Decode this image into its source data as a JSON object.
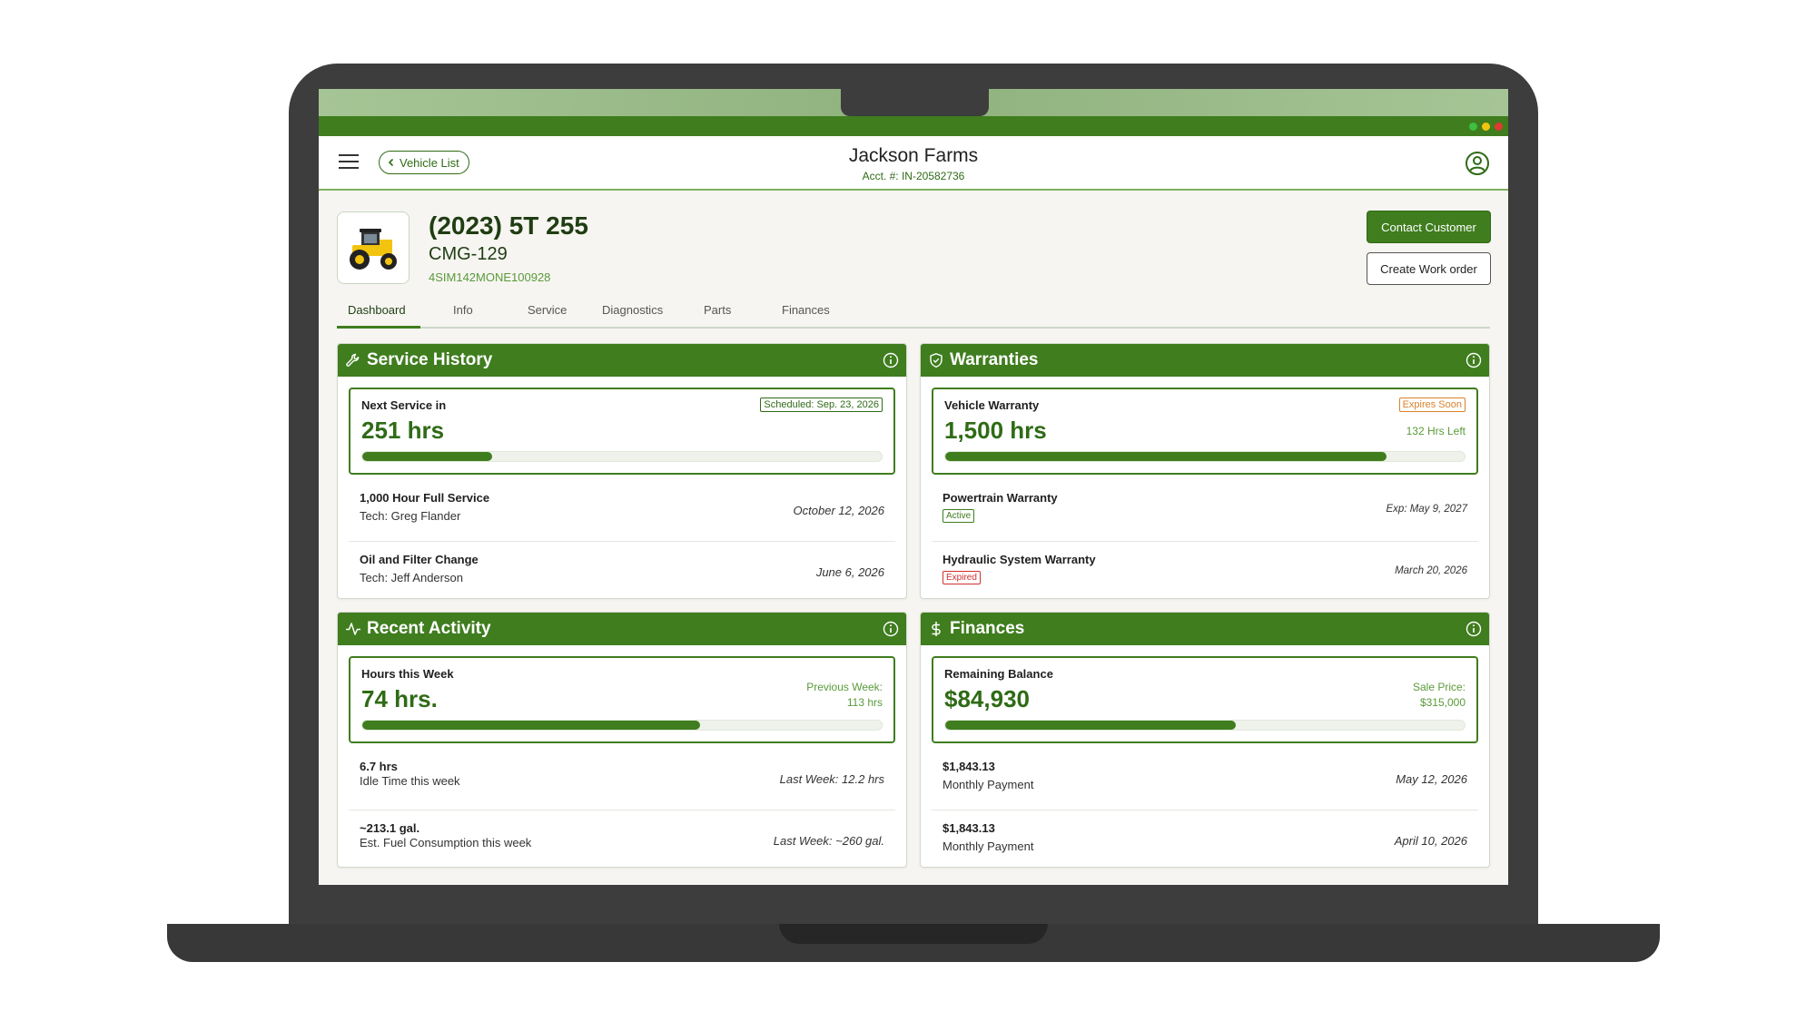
{
  "colors": {
    "primary": "#3f7d1e",
    "primary_dark": "#2f6b16",
    "accent_light": "#5a9a3a",
    "warning": "#d9822b",
    "danger": "#d12f2f",
    "window_dot_green": "#3fbf3f",
    "window_dot_yellow": "#f2c40f",
    "window_dot_red": "#e03a2f"
  },
  "header": {
    "back_label": "Vehicle List",
    "farm_name": "Jackson Farms",
    "account": "Acct. #: IN-20582736"
  },
  "vehicle": {
    "year_model": "(2023) 5T 255",
    "code": "CMG-129",
    "vin": "4SIM142MONE100928",
    "image_icon": "tractor-icon"
  },
  "actions": {
    "contact": "Contact Customer",
    "work_order": "Create Work order"
  },
  "tabs": [
    "Dashboard",
    "Info",
    "Service",
    "Diagnostics",
    "Parts",
    "Finances"
  ],
  "cards": {
    "service_history": {
      "title": "Service History",
      "icon": "wrench-icon",
      "hero": {
        "label": "Next Service in",
        "value": "251 hrs",
        "badge": "Scheduled: Sep. 23, 2026",
        "progress": 0.25
      },
      "rows": [
        {
          "title": "1,000 Hour Full Service",
          "sub": "Tech: Greg Flander",
          "right": "October 12, 2026"
        },
        {
          "title": "Oil and Filter Change",
          "sub": "Tech: Jeff Anderson",
          "right": "June 6, 2026"
        }
      ]
    },
    "warranties": {
      "title": "Warranties",
      "icon": "shield-check-icon",
      "hero": {
        "label": "Vehicle Warranty",
        "value": "1,500 hrs",
        "badge": "Expires Soon",
        "right": "132 Hrs Left",
        "progress": 0.85
      },
      "rows": [
        {
          "title": "Powertrain Warranty",
          "badge": "Active",
          "right": "Exp: May 9, 2027"
        },
        {
          "title": "Hydraulic System Warranty",
          "badge": "Expired",
          "right": "March 20, 2026"
        }
      ]
    },
    "recent_activity": {
      "title": "Recent Activity",
      "icon": "activity-icon",
      "hero": {
        "label": "Hours this Week",
        "value": "74 hrs.",
        "right_line1": "Previous Week:",
        "right_line2": "113 hrs",
        "progress": 0.65
      },
      "rows": [
        {
          "title": "6.7 hrs",
          "sub": "Idle Time this week",
          "right": "Last Week: 12.2 hrs"
        },
        {
          "title": "~213.1 gal.",
          "sub": "Est. Fuel Consumption this week",
          "right": "Last Week: ~260 gal."
        }
      ]
    },
    "finances": {
      "title": "Finances",
      "icon": "dollar-icon",
      "hero": {
        "label": "Remaining Balance",
        "value": "$84,930",
        "right_line1": "Sale Price:",
        "right_line2": "$315,000",
        "progress": 0.56
      },
      "rows": [
        {
          "title": "$1,843.13",
          "sub": "Monthly Payment",
          "right": "May 12, 2026"
        },
        {
          "title": "$1,843.13",
          "sub": "Monthly Payment",
          "right": "April 10, 2026"
        }
      ]
    }
  }
}
